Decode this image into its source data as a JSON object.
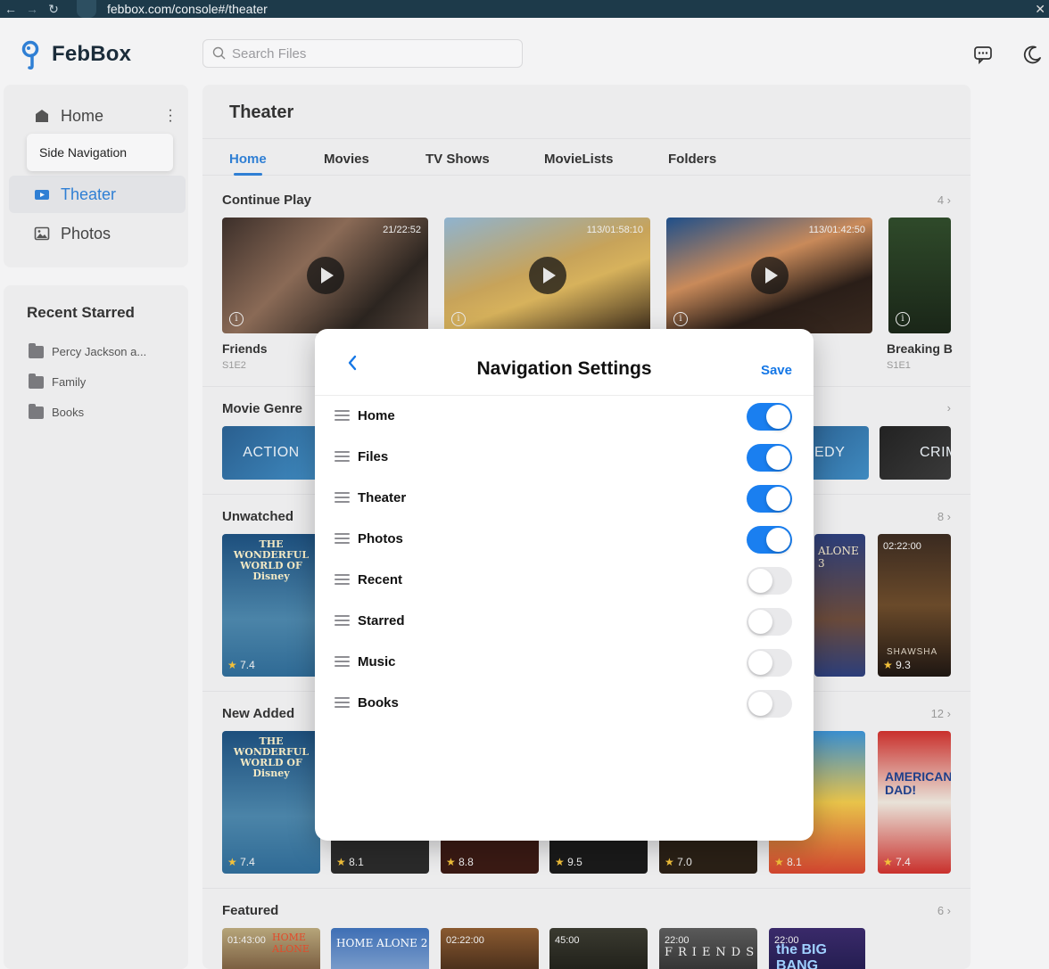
{
  "browser": {
    "url": "febbox.com/console#/theater"
  },
  "app": {
    "name": "FebBox",
    "brand_color": "#2f7fd4"
  },
  "search": {
    "placeholder": "Search Files"
  },
  "sidebar": {
    "items": [
      {
        "label": "Home",
        "icon": "home-icon"
      },
      {
        "label": "Theater",
        "icon": "video-icon",
        "active": true
      },
      {
        "label": "Photos",
        "icon": "image-icon"
      }
    ],
    "tooltip": "Side Navigation",
    "recent_starred_title": "Recent Starred",
    "starred": [
      "Percy Jackson a...",
      "Family",
      "Books"
    ]
  },
  "main": {
    "title": "Theater",
    "tabs": [
      "Home",
      "Movies",
      "TV Shows",
      "MovieLists",
      "Folders"
    ],
    "active_tab": "Home",
    "sections": {
      "continue_play": {
        "title": "Continue Play",
        "count": "4",
        "items": [
          {
            "title": "Friends",
            "sub": "S1E2",
            "duration": "21/22:52"
          },
          {
            "title": "",
            "sub": "",
            "duration": "113/01:58:10"
          },
          {
            "title": "",
            "sub": "",
            "duration": "113/01:42:50"
          },
          {
            "title": "Breaking B",
            "sub": "S1E1",
            "duration": ""
          }
        ]
      },
      "movie_genre": {
        "title": "Movie Genre",
        "genres": [
          "ACTION",
          "EDY",
          "CRIM"
        ]
      },
      "unwatched": {
        "title": "Unwatched",
        "count": "8",
        "ratings": [
          "7.4",
          "9.3"
        ],
        "durations": [
          "02:22:00"
        ],
        "posters": [
          "THE WONDERFUL WORLD OF Disney",
          "ALONE 3",
          "SHAWSHA"
        ]
      },
      "new_added": {
        "title": "New Added",
        "count": "12",
        "ratings": [
          "7.4",
          "8.1",
          "8.8",
          "9.5",
          "7.0",
          "8.1",
          "7.4"
        ],
        "posters": [
          "THE WONDERFUL WORLD OF Disney",
          "AMERICAN DAD!"
        ]
      },
      "featured": {
        "title": "Featured",
        "count": "6",
        "durations": [
          "01:43:00",
          "02:22:00",
          "45:00",
          "22:00",
          "22:00"
        ],
        "posters": [
          "HOME ALONE",
          "HOME ALONE 2",
          "FRIENDS",
          "the BIG BANG"
        ]
      }
    }
  },
  "modal": {
    "title": "Navigation Settings",
    "save_label": "Save",
    "items": [
      {
        "label": "Home",
        "enabled": true
      },
      {
        "label": "Files",
        "enabled": true
      },
      {
        "label": "Theater",
        "enabled": true
      },
      {
        "label": "Photos",
        "enabled": true
      },
      {
        "label": "Recent",
        "enabled": false
      },
      {
        "label": "Starred",
        "enabled": false
      },
      {
        "label": "Music",
        "enabled": false
      },
      {
        "label": "Books",
        "enabled": false
      }
    ],
    "toggle_on_color": "#1a7ff0",
    "toggle_off_color": "#e9e9eb"
  }
}
